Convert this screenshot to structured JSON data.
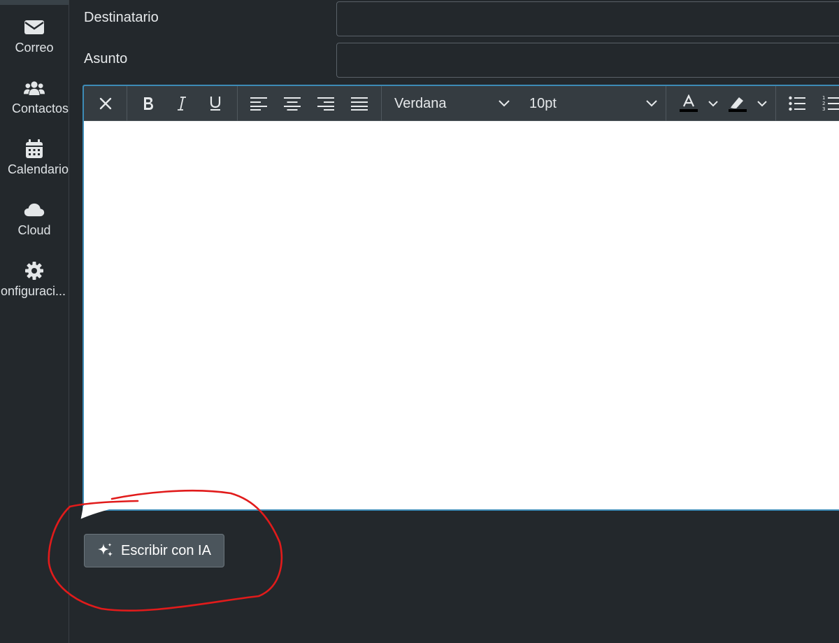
{
  "sidebar": {
    "items": [
      {
        "label": "Correo",
        "icon": "envelope-icon"
      },
      {
        "label": "Contactos",
        "icon": "users-icon"
      },
      {
        "label": "Calendario",
        "icon": "calendar-icon"
      },
      {
        "label": "Cloud",
        "icon": "cloud-icon"
      },
      {
        "label": "onfiguraci...",
        "icon": "gear-icon"
      }
    ]
  },
  "form": {
    "to_label": "Destinatario",
    "to_value": "",
    "subject_label": "Asunto",
    "subject_value": ""
  },
  "toolbar": {
    "font_family": "Verdana",
    "font_size": "10pt"
  },
  "ai_button": {
    "label": "Escribir con IA",
    "icon": "sparkle-icon"
  },
  "colors": {
    "background": "#23282c",
    "toolbar": "#353c41",
    "editor_border": "#3d8bb6",
    "annotation": "#e11b1b",
    "ai_button": "#4b555c"
  }
}
